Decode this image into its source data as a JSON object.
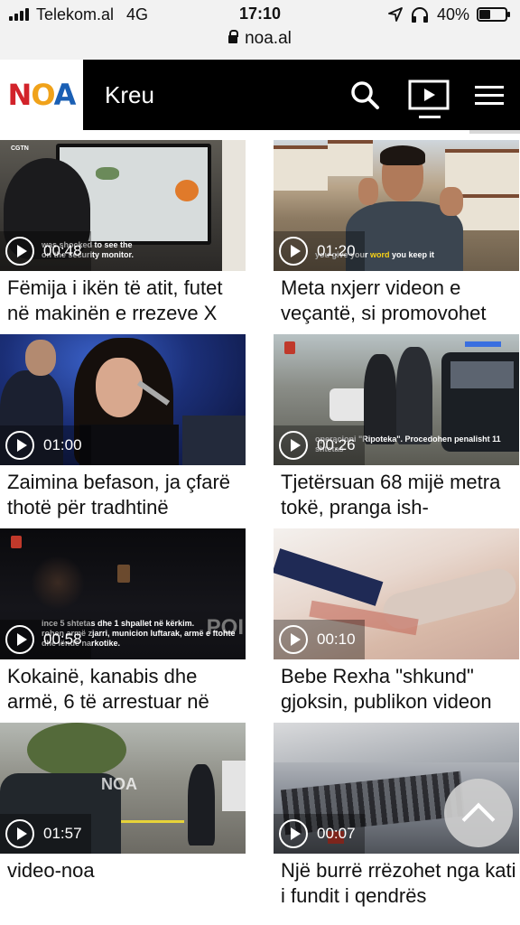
{
  "status_bar": {
    "carrier": "Telekom.al",
    "network": "4G",
    "time": "17:10",
    "battery": "40%",
    "url": "noa.al"
  },
  "header": {
    "logo": {
      "n": "N",
      "o": "O",
      "a": "A"
    },
    "title": "Kreu",
    "brand_colors": {
      "red": "#d2232a",
      "orange": "#f0a21a",
      "blue": "#1a5fb4"
    }
  },
  "videos": [
    {
      "duration": "00:48",
      "title": "Fëmija i ikën të atit, futet në makinën e rrezeve X",
      "caption_line1": "was shocked to see the",
      "caption_line2": "on the security monitor.",
      "channel": "CGTN"
    },
    {
      "duration": "01:20",
      "title": "Meta nxjerr videon e veçantë, si promovohet",
      "caption_pre": "you give your ",
      "caption_highlight": "word",
      "caption_post": " you keep it"
    },
    {
      "duration": "01:00",
      "title": "Zaimina befason, ja çfarë thotë për tradhtinë"
    },
    {
      "duration": "00:26",
      "title": "Tjetërsuan 68 mijë metra tokë, pranga ish-",
      "caption": "operacioni \"Ripoteka\". Procedohen penalisht 11 shtetas"
    },
    {
      "duration": "00:58",
      "title": "Kokainë, kanabis dhe armë, 6 të arrestuar në",
      "caption_line1": "ince 5 shtetas dhe 1 shpallet në kërkim.",
      "caption_line2": "rohen armë zjarri, municion luftarak, armë e ftohte dhe lëndë narkotike.",
      "overlay": "POI"
    },
    {
      "duration": "00:10",
      "title": "Bebe Rexha \"shkund\" gjoksin, publikon videon"
    },
    {
      "duration": "01:57",
      "title": "video-noa",
      "watermark": "NOA"
    },
    {
      "duration": "00:07",
      "title": "Një burrë rrëzohet nga kati i fundit i qendrës"
    }
  ]
}
